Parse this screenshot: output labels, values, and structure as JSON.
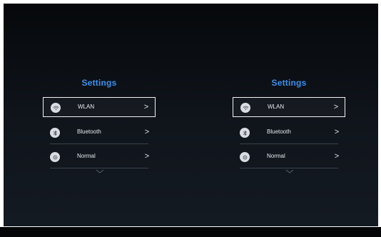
{
  "panels": [
    {
      "title": "Settings",
      "items": [
        {
          "label": "WLAN",
          "icon": "wifi-icon",
          "selected": true
        },
        {
          "label": "Bluetooth",
          "icon": "bluetooth-icon",
          "selected": false
        },
        {
          "label": "Normal",
          "icon": "normal-icon",
          "selected": false
        }
      ],
      "chevron": ">",
      "more": "chevron-down-icon"
    },
    {
      "title": "Settings",
      "items": [
        {
          "label": "WLAN",
          "icon": "wifi-icon",
          "selected": true
        },
        {
          "label": "Bluetooth",
          "icon": "bluetooth-icon",
          "selected": false
        },
        {
          "label": "Normal",
          "icon": "normal-icon",
          "selected": false
        }
      ],
      "chevron": ">",
      "more": "chevron-down-icon"
    }
  ],
  "colors": {
    "accent": "#3f8ff0",
    "background_top": "#06080b",
    "background_bottom": "#141a22",
    "text": "#e7eaee",
    "selection_border": "#f2f2f2"
  }
}
